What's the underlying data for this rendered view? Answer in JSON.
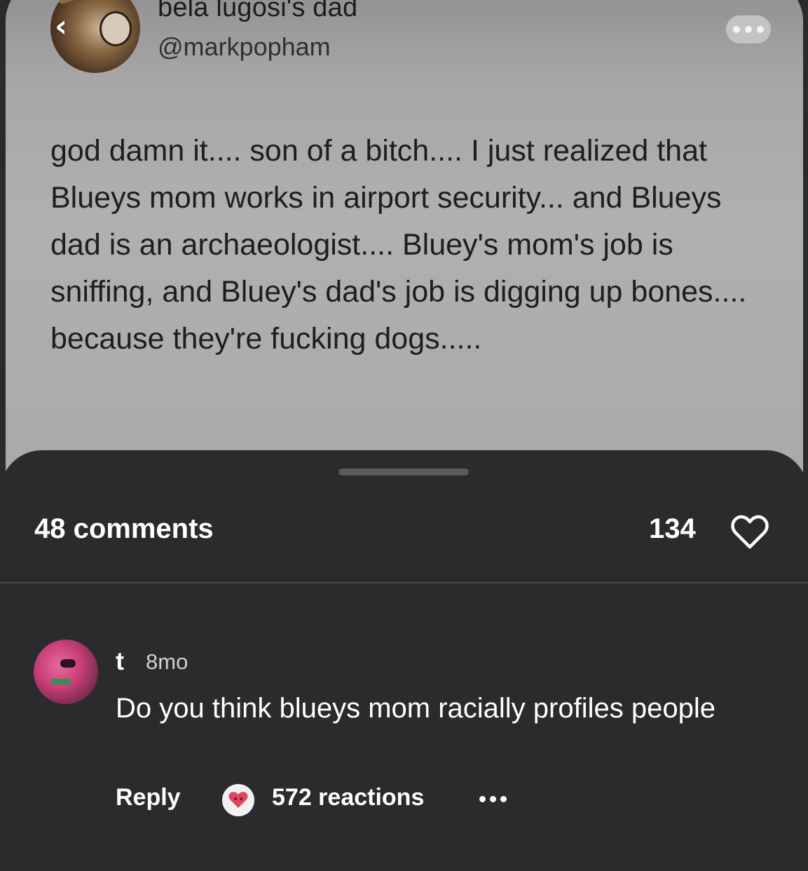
{
  "post": {
    "display_name": "bela lugosi's dad",
    "handle": "@markpopham",
    "avatar_icon": "profile-avatar",
    "back_icon": "chevron-left-icon",
    "more_icon": "ellipsis-icon",
    "text": "god damn it.... son of a bitch.... I just realized that Blueys mom works in airport security... and Blueys dad is an archaeologist.... Bluey's mom's job is sniffing, and Bluey's dad's job is digging up bones.... because they're fucking dogs....."
  },
  "sheet": {
    "comments_label": "48 comments",
    "likes_count": "134",
    "heart_icon": "heart-outline-icon"
  },
  "comment": {
    "user": "t",
    "time": "8mo",
    "text": "Do you think blueys mom racially profiles people",
    "reply_label": "Reply",
    "reaction_icon": "heart-face-icon",
    "reactions_label": "572 reactions",
    "more_icon": "ellipsis-icon"
  },
  "colors": {
    "card_bg": "#b0b0b0",
    "sheet_bg": "#2b2b2d",
    "text_light": "#ffffff",
    "text_dark": "#1e1e1e"
  }
}
